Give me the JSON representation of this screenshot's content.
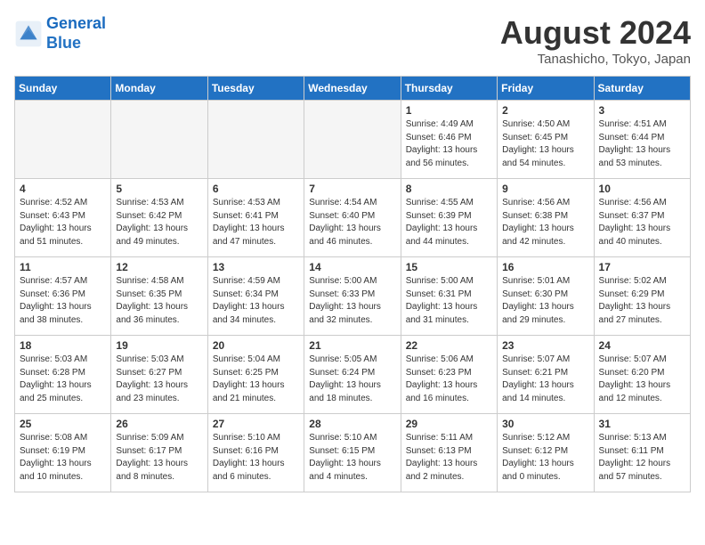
{
  "header": {
    "logo_line1": "General",
    "logo_line2": "Blue",
    "month_title": "August 2024",
    "location": "Tanashicho, Tokyo, Japan"
  },
  "weekdays": [
    "Sunday",
    "Monday",
    "Tuesday",
    "Wednesday",
    "Thursday",
    "Friday",
    "Saturday"
  ],
  "weeks": [
    [
      {
        "day": "",
        "empty": true
      },
      {
        "day": "",
        "empty": true
      },
      {
        "day": "",
        "empty": true
      },
      {
        "day": "",
        "empty": true
      },
      {
        "day": "1",
        "sunrise": "4:49 AM",
        "sunset": "6:46 PM",
        "daylight": "13 hours and 56 minutes."
      },
      {
        "day": "2",
        "sunrise": "4:50 AM",
        "sunset": "6:45 PM",
        "daylight": "13 hours and 54 minutes."
      },
      {
        "day": "3",
        "sunrise": "4:51 AM",
        "sunset": "6:44 PM",
        "daylight": "13 hours and 53 minutes."
      }
    ],
    [
      {
        "day": "4",
        "sunrise": "4:52 AM",
        "sunset": "6:43 PM",
        "daylight": "13 hours and 51 minutes."
      },
      {
        "day": "5",
        "sunrise": "4:53 AM",
        "sunset": "6:42 PM",
        "daylight": "13 hours and 49 minutes."
      },
      {
        "day": "6",
        "sunrise": "4:53 AM",
        "sunset": "6:41 PM",
        "daylight": "13 hours and 47 minutes."
      },
      {
        "day": "7",
        "sunrise": "4:54 AM",
        "sunset": "6:40 PM",
        "daylight": "13 hours and 46 minutes."
      },
      {
        "day": "8",
        "sunrise": "4:55 AM",
        "sunset": "6:39 PM",
        "daylight": "13 hours and 44 minutes."
      },
      {
        "day": "9",
        "sunrise": "4:56 AM",
        "sunset": "6:38 PM",
        "daylight": "13 hours and 42 minutes."
      },
      {
        "day": "10",
        "sunrise": "4:56 AM",
        "sunset": "6:37 PM",
        "daylight": "13 hours and 40 minutes."
      }
    ],
    [
      {
        "day": "11",
        "sunrise": "4:57 AM",
        "sunset": "6:36 PM",
        "daylight": "13 hours and 38 minutes."
      },
      {
        "day": "12",
        "sunrise": "4:58 AM",
        "sunset": "6:35 PM",
        "daylight": "13 hours and 36 minutes."
      },
      {
        "day": "13",
        "sunrise": "4:59 AM",
        "sunset": "6:34 PM",
        "daylight": "13 hours and 34 minutes."
      },
      {
        "day": "14",
        "sunrise": "5:00 AM",
        "sunset": "6:33 PM",
        "daylight": "13 hours and 32 minutes."
      },
      {
        "day": "15",
        "sunrise": "5:00 AM",
        "sunset": "6:31 PM",
        "daylight": "13 hours and 31 minutes."
      },
      {
        "day": "16",
        "sunrise": "5:01 AM",
        "sunset": "6:30 PM",
        "daylight": "13 hours and 29 minutes."
      },
      {
        "day": "17",
        "sunrise": "5:02 AM",
        "sunset": "6:29 PM",
        "daylight": "13 hours and 27 minutes."
      }
    ],
    [
      {
        "day": "18",
        "sunrise": "5:03 AM",
        "sunset": "6:28 PM",
        "daylight": "13 hours and 25 minutes."
      },
      {
        "day": "19",
        "sunrise": "5:03 AM",
        "sunset": "6:27 PM",
        "daylight": "13 hours and 23 minutes."
      },
      {
        "day": "20",
        "sunrise": "5:04 AM",
        "sunset": "6:25 PM",
        "daylight": "13 hours and 21 minutes."
      },
      {
        "day": "21",
        "sunrise": "5:05 AM",
        "sunset": "6:24 PM",
        "daylight": "13 hours and 18 minutes."
      },
      {
        "day": "22",
        "sunrise": "5:06 AM",
        "sunset": "6:23 PM",
        "daylight": "13 hours and 16 minutes."
      },
      {
        "day": "23",
        "sunrise": "5:07 AM",
        "sunset": "6:21 PM",
        "daylight": "13 hours and 14 minutes."
      },
      {
        "day": "24",
        "sunrise": "5:07 AM",
        "sunset": "6:20 PM",
        "daylight": "13 hours and 12 minutes."
      }
    ],
    [
      {
        "day": "25",
        "sunrise": "5:08 AM",
        "sunset": "6:19 PM",
        "daylight": "13 hours and 10 minutes."
      },
      {
        "day": "26",
        "sunrise": "5:09 AM",
        "sunset": "6:17 PM",
        "daylight": "13 hours and 8 minutes."
      },
      {
        "day": "27",
        "sunrise": "5:10 AM",
        "sunset": "6:16 PM",
        "daylight": "13 hours and 6 minutes."
      },
      {
        "day": "28",
        "sunrise": "5:10 AM",
        "sunset": "6:15 PM",
        "daylight": "13 hours and 4 minutes."
      },
      {
        "day": "29",
        "sunrise": "5:11 AM",
        "sunset": "6:13 PM",
        "daylight": "13 hours and 2 minutes."
      },
      {
        "day": "30",
        "sunrise": "5:12 AM",
        "sunset": "6:12 PM",
        "daylight": "13 hours and 0 minutes."
      },
      {
        "day": "31",
        "sunrise": "5:13 AM",
        "sunset": "6:11 PM",
        "daylight": "12 hours and 57 minutes."
      }
    ]
  ]
}
